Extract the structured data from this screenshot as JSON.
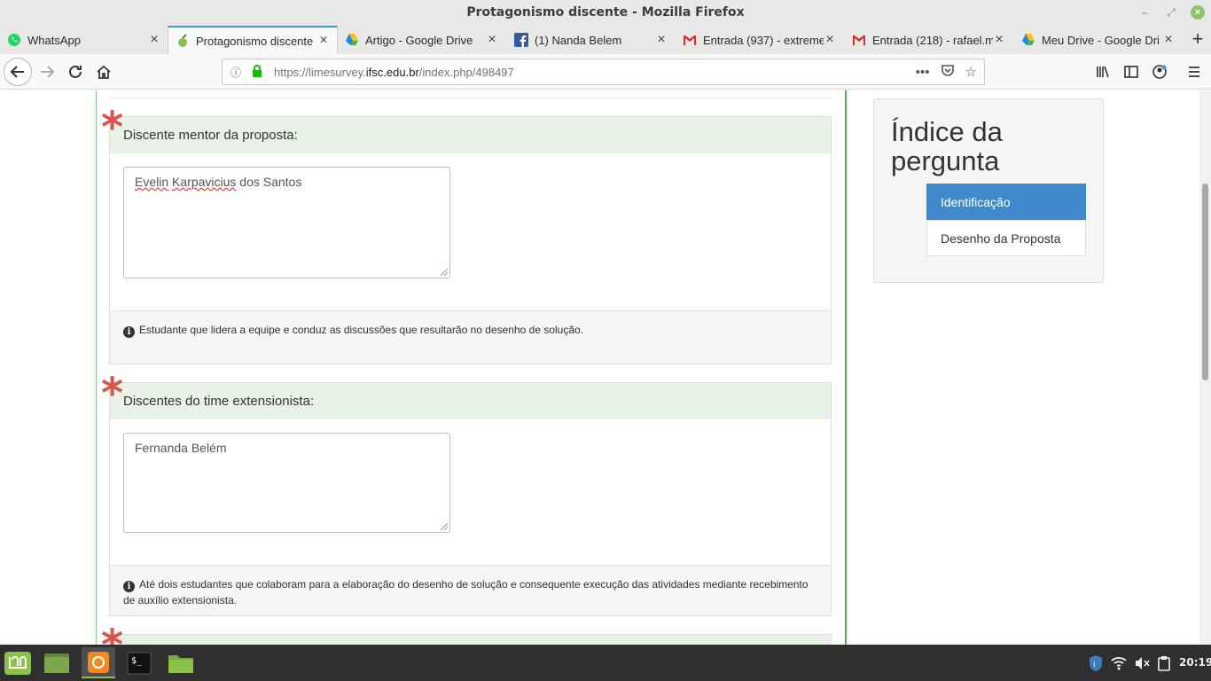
{
  "window": {
    "title": "Protagonismo discente - Mozilla Firefox"
  },
  "tabs": [
    {
      "label": "WhatsApp",
      "icon": "whatsapp-icon",
      "active": false
    },
    {
      "label": "Protagonismo discente",
      "icon": "limesurvey-icon",
      "active": true
    },
    {
      "label": "Artigo - Google Drive",
      "icon": "google-drive-icon",
      "active": false
    },
    {
      "label": "(1) Nanda Belem",
      "icon": "facebook-icon",
      "active": false
    },
    {
      "label": "Entrada (937) - extreme",
      "icon": "gmail-icon",
      "active": false
    },
    {
      "label": "Entrada (218) - rafael.m",
      "icon": "gmail-icon",
      "active": false
    },
    {
      "label": "Meu Drive - Google Dri",
      "icon": "google-drive-icon",
      "active": false
    }
  ],
  "urlbar": {
    "prefix": "https://limesurvey.",
    "host": "ifsc.edu.br",
    "path": "/index.php/498497"
  },
  "questions": [
    {
      "label": "Discente mentor da proposta:",
      "required_mark": "*",
      "answer_parts": [
        {
          "text": "Evelin",
          "misspelled": true
        },
        {
          "text": " ",
          "misspelled": false
        },
        {
          "text": "Karpavicius",
          "misspelled": true
        },
        {
          "text": " dos Santos",
          "misspelled": false
        }
      ],
      "help": "Estudante que lidera a equipe e conduz as discussões que resultarão no desenho de solução."
    },
    {
      "label": "Discentes do time extensionista:",
      "required_mark": "*",
      "answer": "Fernanda Belém",
      "help": "Até dois estudantes que colaboram para a elaboração do desenho de solução e consequente execução das atividades mediante recebimento de auxílio extensionista."
    },
    {
      "required_mark": "*"
    }
  ],
  "index": {
    "title": "Índice da pergunta",
    "items": [
      {
        "label": "Identificação",
        "active": true
      },
      {
        "label": "Desenho da Proposta",
        "active": false
      }
    ]
  },
  "taskbar": {
    "apps": [
      "mint-menu-icon",
      "show-desktop-icon",
      "firefox-icon",
      "terminal-icon",
      "files-icon"
    ],
    "clock": "20:19"
  },
  "colors": {
    "required": "#d9534f",
    "question_header_bg": "#e9f2e7",
    "index_active": "#3e8acc",
    "tab_accent": "#3d9bd6"
  }
}
